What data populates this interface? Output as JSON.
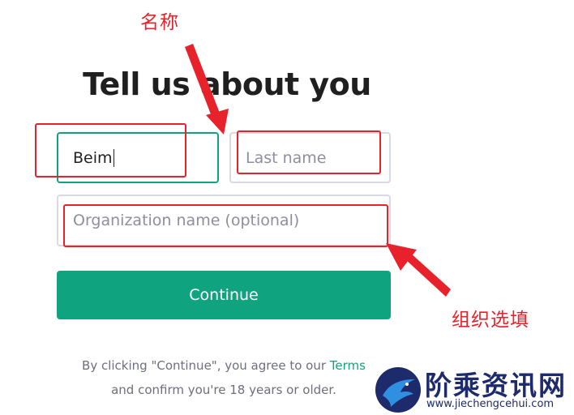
{
  "form": {
    "title": "Tell us about you",
    "first_name_value": "Beim",
    "last_name_placeholder": "Last name",
    "organization_placeholder": "Organization name (optional)",
    "continue_label": "Continue",
    "terms_line1_prefix": "By clicking \"Continue\", you agree to our ",
    "terms_link": "Terms",
    "terms_line2": "and confirm you're 18 years or older."
  },
  "annotations": {
    "name_label": "名称",
    "optional_label": "组织选填",
    "color": "#e8222b"
  },
  "watermark": {
    "text": "阶乘资讯网",
    "url": "www.jiechengcehui.com"
  },
  "colors": {
    "accent": "#10a37f",
    "annotation": "#e8222b",
    "watermark": "#1d2a6b"
  }
}
